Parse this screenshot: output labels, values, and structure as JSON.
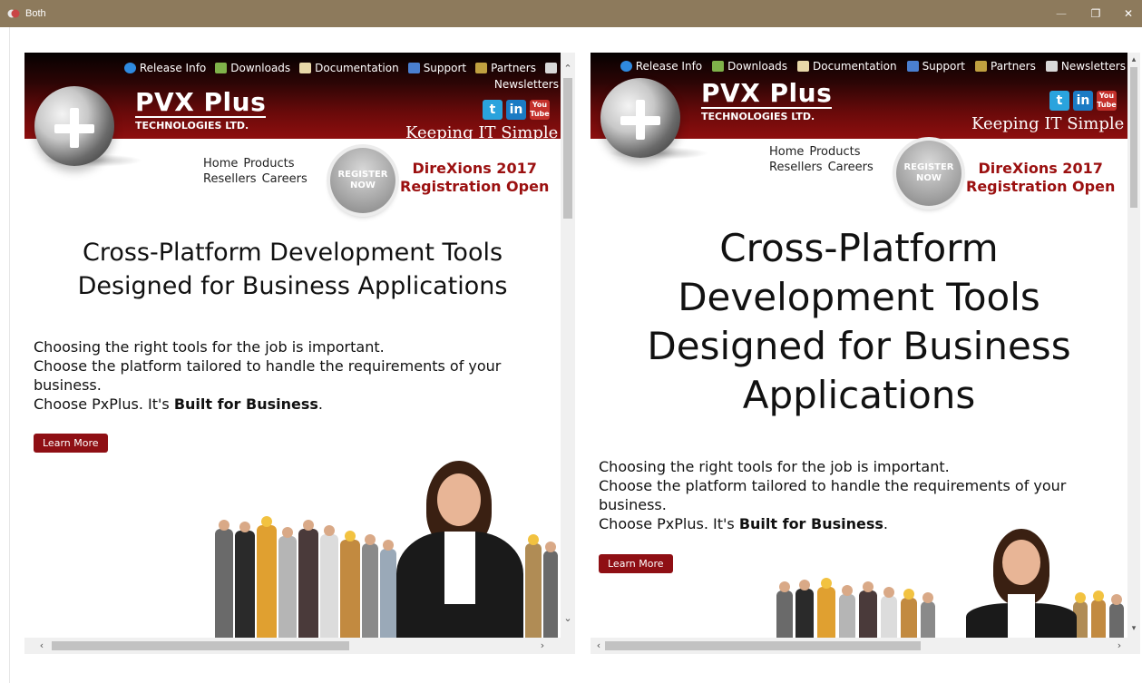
{
  "window": {
    "title": "Both",
    "controls": {
      "minimize": "—",
      "maximize": "❐",
      "close": "✕"
    }
  },
  "site": {
    "nav": {
      "release_info": "Release Info",
      "downloads": "Downloads",
      "documentation": "Documentation",
      "support": "Support",
      "partners": "Partners",
      "newsletters": "Newsletters"
    },
    "brand_name": "PVX Plus",
    "brand_sub": "TECHNOLOGIES LTD.",
    "social": {
      "twitter": "t",
      "linkedin": "in",
      "youtube_top": "You",
      "youtube_bottom": "Tube"
    },
    "tagline": "Keeping IT Simple",
    "links": {
      "home": "Home",
      "products": "Products",
      "resellers": "Resellers",
      "careers": "Careers"
    },
    "register": {
      "line1": "REGISTER",
      "line2": "NOW"
    },
    "promo": {
      "line1": "DireXions 2017",
      "line2": "Registration Open"
    },
    "headline": {
      "left_line1": "Cross-Platform Development Tools",
      "left_line2": "Designed for Business Applications",
      "right_line1": "Cross-Platform",
      "right_line2": "Development Tools",
      "right_line3": "Designed for Business",
      "right_line4": "Applications"
    },
    "body": {
      "p1": "Choosing the right tools for the job is important.",
      "p2_left_a": "Choose the platform tailored to handle the requirements of your",
      "p2_left_b": "business.",
      "p2_right_a": "Choose the platform tailored to handle the requirements of your",
      "p2_right_b": "business.",
      "p3_prefix": "Choose PxPlus. It's ",
      "p3_bold": "Built for Business",
      "p3_suffix": "."
    },
    "learn_more": "Learn More"
  },
  "scrollbars": {
    "left": {
      "up": "⌃",
      "down": "⌄",
      "left": "‹",
      "right": "›"
    },
    "right": {
      "up": "▴",
      "down": "▾",
      "left": "‹",
      "right": "›"
    }
  },
  "colors": {
    "titlebar": "#8d7a5c",
    "header_dark": "#050101",
    "header_red": "#8e0f0f",
    "promo_red": "#9b1010",
    "button_red": "#8f0f14"
  }
}
